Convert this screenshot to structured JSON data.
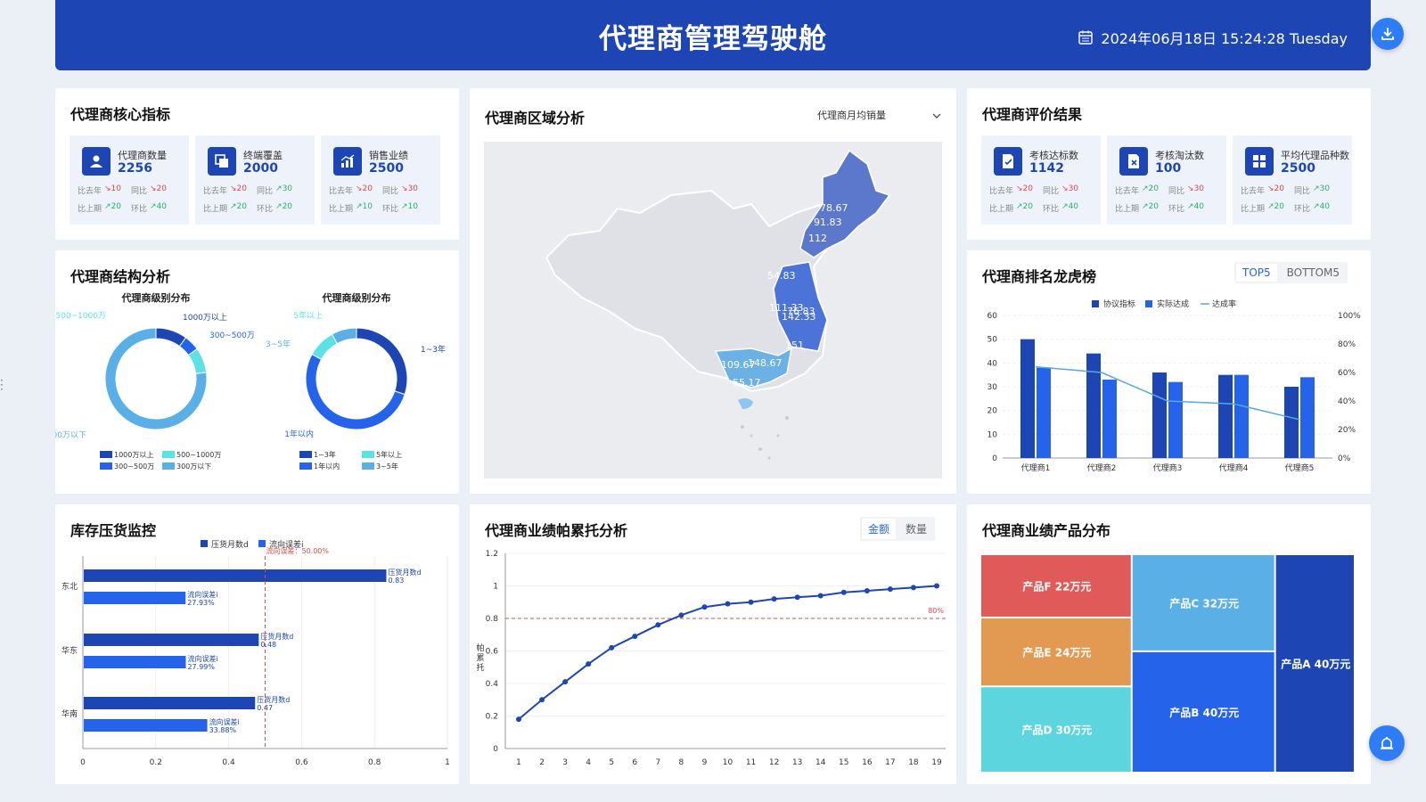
{
  "header": {
    "title": "代理商管理驾驶舱",
    "datetime": "2024年06月18日 15:24:28 Tuesday"
  },
  "icons": {
    "download": "download-icon",
    "calendar": "calendar-icon",
    "alarm": "alarm-icon"
  },
  "core": {
    "title": "代理商核心指标",
    "cards": [
      {
        "label": "代理商数量",
        "value": "2256",
        "icon": "user-icon",
        "r1": [
          "比去年",
          "↘10",
          "同比",
          "↘20"
        ],
        "r1dir": [
          "down",
          "down"
        ],
        "r2": [
          "比上期",
          "↗20",
          "环比",
          "↗40"
        ],
        "r2dir": [
          "up",
          "up"
        ]
      },
      {
        "label": "终端覆盖",
        "value": "2000",
        "icon": "layers-icon",
        "r1": [
          "比去年",
          "↘20",
          "同比",
          "↗30"
        ],
        "r1dir": [
          "down",
          "up"
        ],
        "r2": [
          "比上期",
          "↗20",
          "环比",
          "↗20"
        ],
        "r2dir": [
          "up",
          "up"
        ]
      },
      {
        "label": "销售业绩",
        "value": "2500",
        "icon": "chart-icon",
        "r1": [
          "比去年",
          "↘20",
          "同比",
          "↘30"
        ],
        "r1dir": [
          "down",
          "down"
        ],
        "r2": [
          "比上期",
          "↗10",
          "环比",
          "↗10"
        ],
        "r2dir": [
          "up",
          "up"
        ]
      }
    ]
  },
  "region": {
    "title": "代理商区域分析",
    "select": "代理商月均销量",
    "labels": [
      "78.67",
      "91.83",
      "112",
      "54.83",
      "111.33",
      "76.83",
      "142.33",
      "151",
      "109.67",
      "148.67",
      "55.17"
    ]
  },
  "eval": {
    "title": "代理商评价结果",
    "cards": [
      {
        "label": "考核达标数",
        "value": "1142",
        "icon": "doc-check-icon",
        "r1": [
          "比去年",
          "↘20",
          "同比",
          "↘30"
        ],
        "r1dir": [
          "down",
          "down"
        ],
        "r2": [
          "比上期",
          "↗20",
          "环比",
          "↗40"
        ],
        "r2dir": [
          "up",
          "up"
        ]
      },
      {
        "label": "考核淘汰数",
        "value": "100",
        "icon": "doc-cross-icon",
        "r1": [
          "比去年",
          "↗20",
          "同比",
          "↘30"
        ],
        "r1dir": [
          "up",
          "down"
        ],
        "r2": [
          "比上期",
          "↗20",
          "环比",
          "↗40"
        ],
        "r2dir": [
          "up",
          "up"
        ]
      },
      {
        "label": "平均代理品种数",
        "value": "2500",
        "icon": "grid-icon",
        "r1": [
          "比去年",
          "↘20",
          "同比",
          "↗30"
        ],
        "r1dir": [
          "down",
          "up"
        ],
        "r2": [
          "比上期",
          "↗20",
          "环比",
          "↗40"
        ],
        "r2dir": [
          "up",
          "up"
        ]
      }
    ]
  },
  "structure": {
    "title": "代理商结构分析",
    "donut1_title": "代理商级别分布",
    "donut2_title": "代理商级别分布"
  },
  "ranking": {
    "title": "代理商排名龙虎榜",
    "tabs": [
      "TOP5",
      "BOTTOM5"
    ]
  },
  "inventory": {
    "title": "库存压货监控",
    "markline": "流向误差：50.00%"
  },
  "pareto": {
    "title": "代理商业绩帕累托分析",
    "tabs": [
      "金额",
      "数量"
    ],
    "markline": "80%"
  },
  "products": {
    "title": "代理商业绩产品分布"
  },
  "chart_data": [
    {
      "type": "pie",
      "title": "代理商级别分布",
      "categories": [
        "1000万以上",
        "300~500万",
        "500~1000万",
        "300万以下"
      ],
      "values": [
        10,
        5,
        8,
        77
      ],
      "colors": [
        "#1d46b4",
        "#2563eb",
        "#5be1e6",
        "#5ab0e6"
      ],
      "legend": "bottom"
    },
    {
      "type": "pie",
      "title": "代理商级别分布",
      "categories": [
        "1~3年",
        "1年以内",
        "5年以上",
        "3~5年"
      ],
      "values": [
        30,
        53,
        9,
        8
      ],
      "colors": [
        "#1d46b4",
        "#2563eb",
        "#5be1e6",
        "#5ab0e6"
      ],
      "legend": "bottom"
    },
    {
      "type": "bar",
      "categories": [
        "代理商1",
        "代理商2",
        "代理商3",
        "代理商4",
        "代理商5"
      ],
      "series": [
        {
          "name": "协议指标",
          "values": [
            50,
            44,
            36,
            35,
            30
          ],
          "color": "#1d46b4"
        },
        {
          "name": "实际达成",
          "values": [
            38,
            33,
            32,
            35,
            34
          ],
          "color": "#2563eb"
        },
        {
          "name": "达成率",
          "values": [
            0.64,
            0.6,
            0.4,
            0.38,
            0.27
          ],
          "type": "line",
          "axis": "right",
          "color": "#5aa7e0"
        }
      ],
      "ylim": [
        0,
        60
      ],
      "yticks": [
        0,
        10,
        20,
        30,
        40,
        50,
        60
      ],
      "y2lim": [
        0,
        1
      ],
      "y2ticks": [
        "0%",
        "20%",
        "40%",
        "60%",
        "80%",
        "100%"
      ],
      "legend": "top"
    },
    {
      "type": "bar",
      "orientation": "horizontal",
      "categories": [
        "东北",
        "华东",
        "华南"
      ],
      "series": [
        {
          "name": "压货月数d",
          "values": [
            0.83,
            0.48,
            0.47
          ],
          "color": "#1d46b4",
          "label_prefix": "压货月数d"
        },
        {
          "name": "流向误差i",
          "values": [
            0.2793,
            0.2799,
            0.3388
          ],
          "color": "#2563eb",
          "label_prefix": "流向误差i",
          "labels": [
            "27.93%",
            "27.99%",
            "33.88%"
          ]
        }
      ],
      "xlim": [
        0,
        1
      ],
      "xticks": [
        0,
        0.2,
        0.4,
        0.6,
        0.8,
        1
      ],
      "markline": 0.5,
      "legend": "top"
    },
    {
      "type": "line",
      "x": [
        1,
        2,
        3,
        4,
        5,
        6,
        7,
        8,
        9,
        10,
        11,
        12,
        13,
        14,
        15,
        16,
        17,
        18,
        19
      ],
      "values": [
        0.18,
        0.3,
        0.41,
        0.52,
        0.62,
        0.69,
        0.76,
        0.82,
        0.87,
        0.89,
        0.9,
        0.92,
        0.93,
        0.94,
        0.96,
        0.97,
        0.98,
        0.99,
        1.0
      ],
      "ylabel": "帕累托",
      "ylim": [
        0,
        1.2
      ],
      "yticks": [
        0,
        0.2,
        0.4,
        0.6,
        0.8,
        1,
        1.2
      ],
      "markline": 0.8
    },
    {
      "type": "heatmap",
      "subtype": "treemap",
      "items": [
        {
          "name": "产品F",
          "value": 22,
          "label": "22万元",
          "color": "#e05a5a"
        },
        {
          "name": "产品E",
          "value": 24,
          "label": "24万元",
          "color": "#e29a52"
        },
        {
          "name": "产品D",
          "value": 30,
          "label": "30万元",
          "color": "#5cd5df"
        },
        {
          "name": "产品C",
          "value": 32,
          "label": "32万元",
          "color": "#5ab0e6"
        },
        {
          "name": "产品B",
          "value": 40,
          "label": "40万元",
          "color": "#2563eb"
        },
        {
          "name": "产品A",
          "value": 40,
          "label": "40万元",
          "color": "#1d46b4"
        }
      ]
    }
  ]
}
